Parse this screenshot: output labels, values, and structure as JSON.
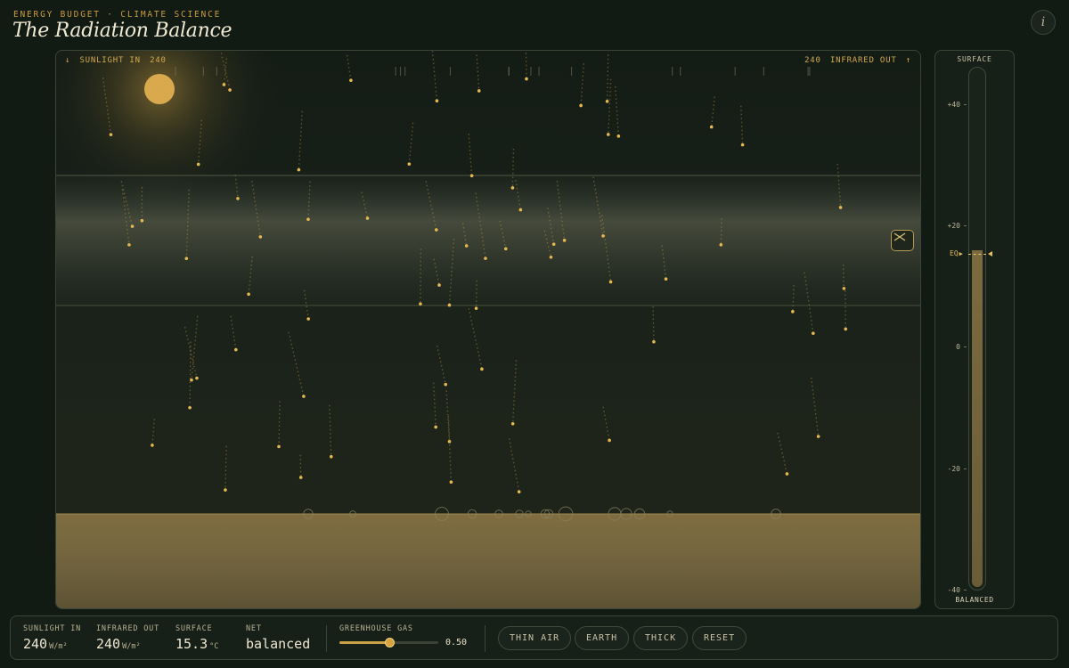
{
  "header": {
    "eyebrow": "ENERGY BUDGET · CLIMATE SCIENCE",
    "title": "The Radiation Balance",
    "info_label": "i"
  },
  "scene": {
    "sunlight_label": "SUNLIGHT IN",
    "sunlight_value": "240",
    "sunlight_arrow": "↓",
    "infrared_label": "INFRARED OUT",
    "infrared_value": "240",
    "infrared_arrow": "↑"
  },
  "thermometer": {
    "title": "SURFACE",
    "footer": "BALANCED",
    "ticks": [
      "+40",
      "+20",
      "0",
      "-20",
      "-40"
    ],
    "equilibrium_label": "EQ",
    "level_celsius": 15.3
  },
  "stats": {
    "sunlight_in": {
      "label": "SUNLIGHT IN",
      "value": "240",
      "unit": "W/m²"
    },
    "infrared_out": {
      "label": "INFRARED OUT",
      "value": "240",
      "unit": "W/m²"
    },
    "surface": {
      "label": "SURFACE",
      "value": "15.3",
      "unit": "°C"
    },
    "net": {
      "label": "NET",
      "value": "balanced"
    }
  },
  "greenhouse": {
    "label": "GREENHOUSE GAS",
    "value": "0.50",
    "fraction": 0.5
  },
  "presets": {
    "thin_air": "THIN AIR",
    "earth": "EARTH",
    "thick": "THICK",
    "reset": "RESET"
  },
  "colors": {
    "accent": "#d6a43c",
    "ground": "#7a6a40",
    "background": "#121a14"
  }
}
